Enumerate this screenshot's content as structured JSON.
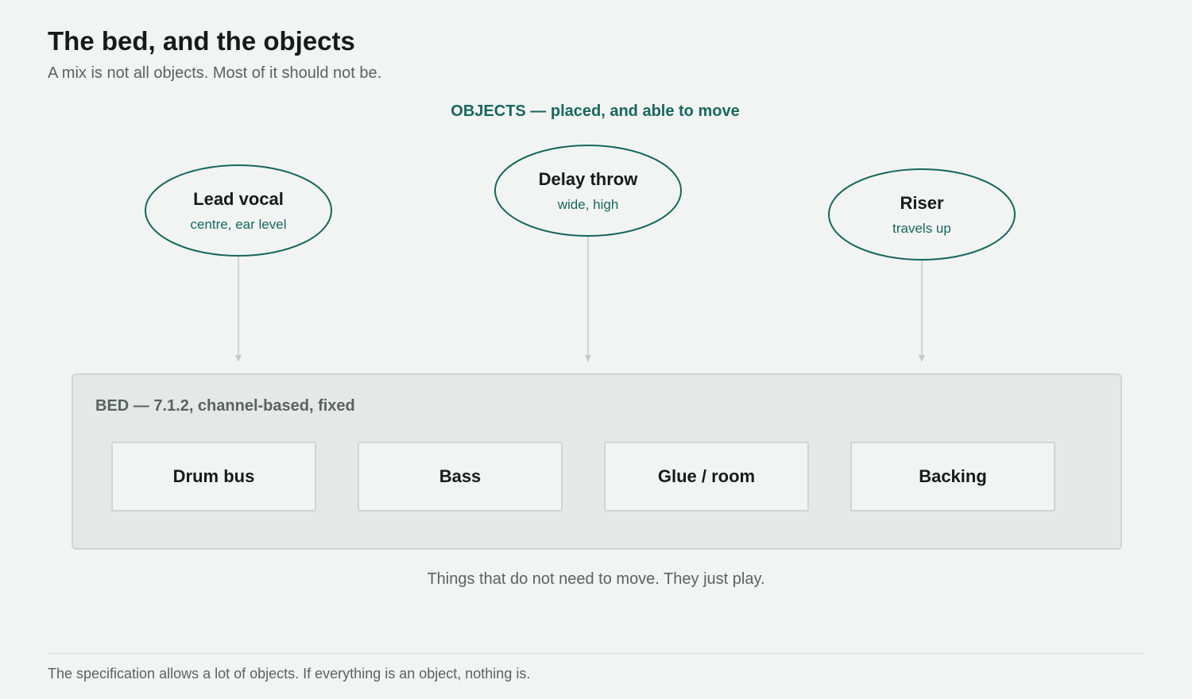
{
  "header": {
    "title": "The bed, and the objects",
    "subtitle": "A mix is not all objects. Most of it should not be."
  },
  "objects": {
    "heading": "OBJECTS — placed, and able to move",
    "items": [
      {
        "name": "Lead vocal",
        "detail": "centre, ear level"
      },
      {
        "name": "Delay throw",
        "detail": "wide, high"
      },
      {
        "name": "Riser",
        "detail": "travels up"
      }
    ]
  },
  "bed": {
    "label": "BED — 7.1.2, channel-based, fixed",
    "items": [
      "Drum bus",
      "Bass",
      "Glue / room",
      "Backing"
    ],
    "caption": "Things that do not need to move. They just play."
  },
  "footer": {
    "note": "The specification allows a lot of objects. If everything is an object, nothing is."
  },
  "colors": {
    "accent": "#17675d",
    "background": "#f2f4f3",
    "bed_fill": "#e4e8e6",
    "border": "#cfd5d2",
    "muted_text": "#5a625f"
  }
}
